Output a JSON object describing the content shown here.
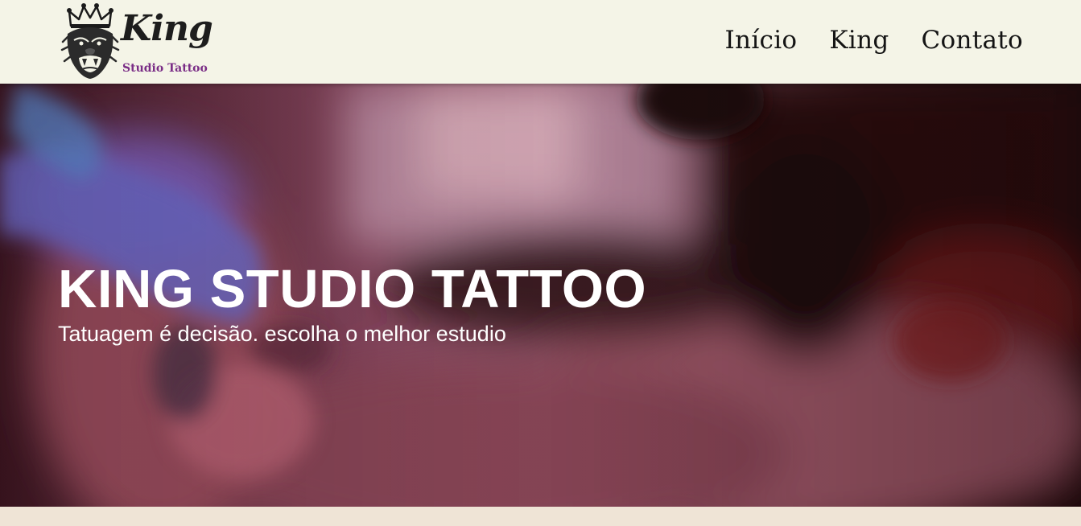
{
  "header": {
    "logo": {
      "title": "King",
      "subtitle": "Studio Tattoo"
    },
    "nav": [
      {
        "label": "Início"
      },
      {
        "label": "King"
      },
      {
        "label": "Contato"
      }
    ]
  },
  "hero": {
    "title": "KING STUDIO TATTOO",
    "subtitle": "Tatuagem é decisão. escolha o melhor estudio"
  },
  "colors": {
    "header_bg": "#f4f4e7",
    "logo_accent": "#7a2d86",
    "hero_text": "#ffffff",
    "page_bg": "#efe4d6"
  }
}
